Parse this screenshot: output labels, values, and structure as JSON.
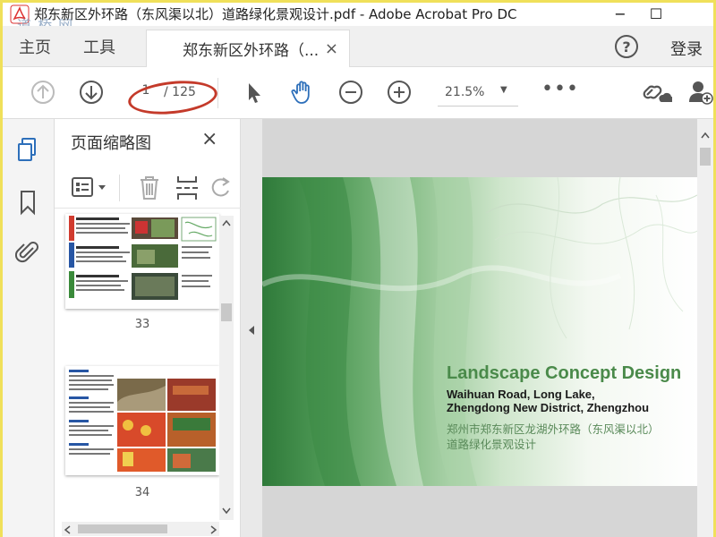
{
  "window": {
    "title": "郑东新区外环路（东风渠以北）道路绿化景观设计.pdf - Adobe Acrobat Pro DC",
    "minimize_glyph": "−",
    "maximize_glyph": "☐",
    "watermark_text": "道 桥 网"
  },
  "menubar": {
    "home_label": "主页",
    "tools_label": "工具",
    "tab_label": "郑东新区外环路（...",
    "tab_close": "×",
    "help_glyph": "?",
    "login_label": "登录"
  },
  "toolbar": {
    "page_current": "1",
    "page_total": "/ 125",
    "zoom_value": "21.5%",
    "zoom_caret": "▼",
    "more_glyph": "•••"
  },
  "sidebar": {
    "title": "页面缩略图",
    "close_glyph": "×"
  },
  "thumbnails": [
    {
      "page": "33"
    },
    {
      "page": "34"
    }
  ],
  "document": {
    "title": "Landscape Concept Design",
    "subtitle_line1": "Waihuan Road, Long Lake,",
    "subtitle_line2": "Zhengdong New District, Zhengzhou",
    "cn_line1": "郑州市郑东新区龙湖外环路（东风渠以北）",
    "cn_line2": "道路绿化景观设计"
  },
  "colors": {
    "accent_blue": "#2d6fba",
    "annotation_red": "#c43a2a",
    "title_green": "#4a8a4a"
  }
}
